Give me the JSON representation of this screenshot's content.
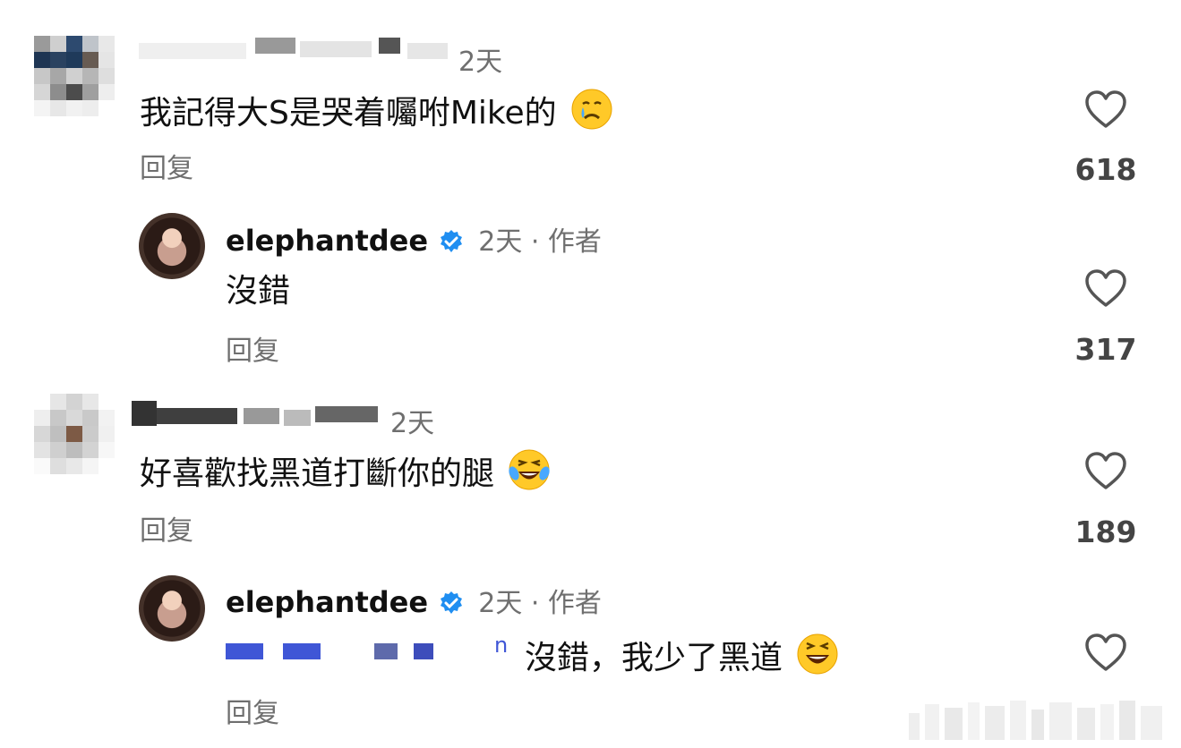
{
  "comments": [
    {
      "username": "",
      "time": "2天",
      "text": "我記得大S是哭着囑咐Mike的",
      "reply_label": "回复",
      "likes": "618",
      "emoji": "crying-face"
    },
    {
      "username": "",
      "time": "2天",
      "text": "好喜歡找黑道打斷你的腿",
      "reply_label": "回复",
      "likes": "189",
      "emoji": "laughing-tears-face"
    }
  ],
  "replies": [
    {
      "username": "elephantdee",
      "meta": "2天 · 作者",
      "text": "沒錯",
      "reply_label": "回复",
      "likes": "317"
    },
    {
      "username": "elephantdee",
      "meta": "2天 · 作者",
      "mention_tail": "n",
      "text": "沒錯，我少了黑道",
      "reply_label": "回复",
      "emoji": "grinning-squint-face"
    }
  ],
  "colors": {
    "verified": "#1f8ef1",
    "secondary_text": "#6f6f6f",
    "mention": "#3f56d6"
  }
}
